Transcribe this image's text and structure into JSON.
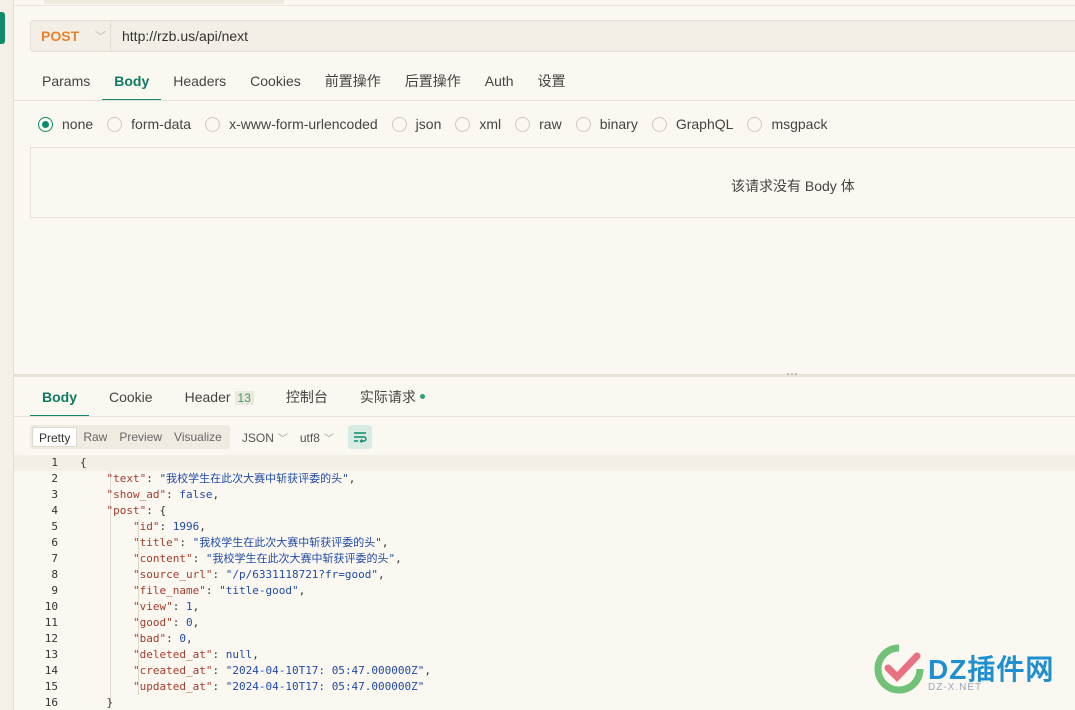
{
  "request": {
    "method": "POST",
    "url": "http://rzb.us/api/next",
    "tabs": [
      "Params",
      "Body",
      "Headers",
      "Cookies",
      "前置操作",
      "后置操作",
      "Auth",
      "设置"
    ],
    "active_tab": "Body",
    "body_types": [
      "none",
      "form-data",
      "x-www-form-urlencoded",
      "json",
      "xml",
      "raw",
      "binary",
      "GraphQL",
      "msgpack"
    ],
    "selected_body_type": "none",
    "empty_message": "该请求没有 Body 体"
  },
  "response": {
    "tabs": [
      {
        "label": "Body"
      },
      {
        "label": "Cookie"
      },
      {
        "label": "Header",
        "count": "13"
      },
      {
        "label": "控制台"
      },
      {
        "label": "实际请求"
      }
    ],
    "view_modes": [
      "Pretty",
      "Raw",
      "Preview",
      "Visualize"
    ],
    "active_view": "Pretty",
    "format": "JSON",
    "encoding": "utf8",
    "code_lines": [
      "{",
      "    \"text\": \"我校学生在此次大赛中斩获评委的头\",",
      "    \"show_ad\": false,",
      "    \"post\": {",
      "        \"id\": 1996,",
      "        \"title\": \"我校学生在此次大赛中斩获评委的头\",",
      "        \"content\": \"我校学生在此次大赛中斩获评委的头\",",
      "        \"source_url\": \"/p/6331118721?fr=good\",",
      "        \"file_name\": \"title-good\",",
      "        \"view\": 1,",
      "        \"good\": 0,",
      "        \"bad\": 0,",
      "        \"deleted_at\": null,",
      "        \"created_at\": \"2024-04-10T17:05:47.000000Z\",",
      "        \"updated_at\": \"2024-04-10T17:05:47.000000Z\"",
      "    }"
    ]
  },
  "watermark": {
    "text": "DZ插件网",
    "sub": "DZ-X.NET"
  },
  "colors": {
    "accent": "#0f8a6c",
    "method": "#e8832b",
    "key": "#a53c2a",
    "string": "#1f4aa8"
  }
}
